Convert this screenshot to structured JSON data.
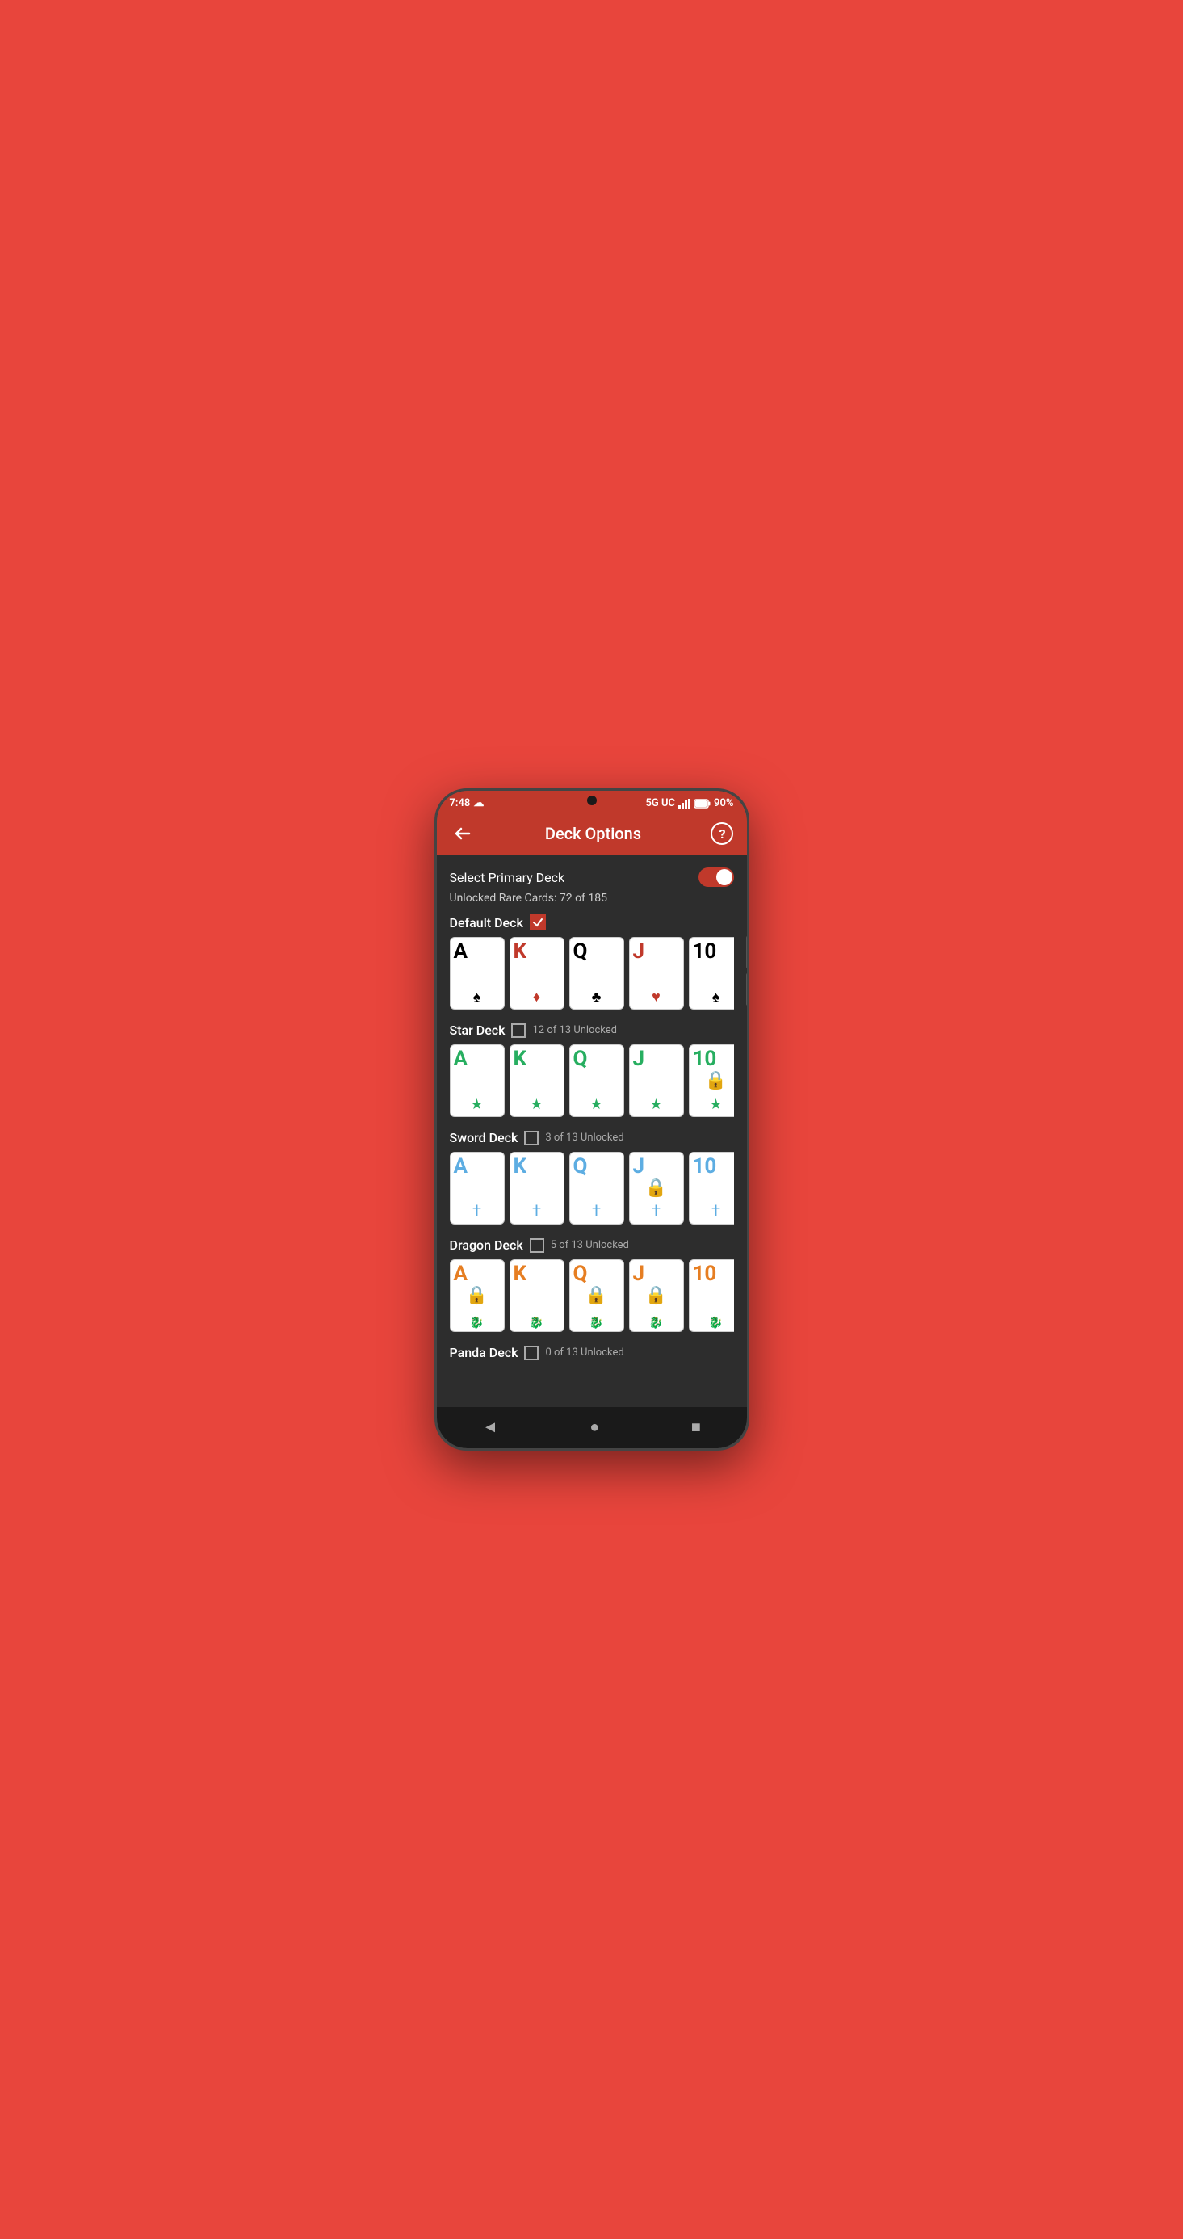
{
  "status_bar": {
    "time": "7:48",
    "network": "5G UC",
    "battery": "90%",
    "cloud_icon": "☁"
  },
  "app_bar": {
    "title": "Deck Options",
    "back_label": "←",
    "help_label": "?"
  },
  "options": {
    "select_primary_deck_label": "Select Primary Deck",
    "unlocked_rare_cards": "Unlocked Rare Cards: 72 of 185"
  },
  "decks": [
    {
      "name": "Default Deck",
      "checked": true,
      "unlock_count": null,
      "cards": [
        {
          "letter": "A",
          "suit": "♠",
          "suit_color": "black",
          "letter_color": "black",
          "locked": false
        },
        {
          "letter": "K",
          "suit": "♦",
          "suit_color": "red",
          "letter_color": "red",
          "locked": false
        },
        {
          "letter": "Q",
          "suit": "♣",
          "suit_color": "black",
          "letter_color": "black",
          "locked": false
        },
        {
          "letter": "J",
          "suit": "♥",
          "suit_color": "red",
          "letter_color": "red",
          "locked": false
        },
        {
          "letter": "10",
          "suit": "♠",
          "suit_color": "black",
          "letter_color": "black",
          "locked": false
        }
      ]
    },
    {
      "name": "Star Deck",
      "checked": false,
      "unlock_count": "12 of 13 Unlocked",
      "cards": [
        {
          "letter": "A",
          "suit": "★",
          "suit_color": "green",
          "letter_color": "green",
          "locked": false
        },
        {
          "letter": "K",
          "suit": "★",
          "suit_color": "green",
          "letter_color": "green",
          "locked": false
        },
        {
          "letter": "Q",
          "suit": "★",
          "suit_color": "green",
          "letter_color": "green",
          "locked": false
        },
        {
          "letter": "J",
          "suit": "★",
          "suit_color": "green",
          "letter_color": "green",
          "locked": false
        },
        {
          "letter": "10",
          "suit": "★",
          "suit_color": "green",
          "letter_color": "green",
          "locked": true
        }
      ]
    },
    {
      "name": "Sword Deck",
      "checked": false,
      "unlock_count": "3 of 13 Unlocked",
      "cards": [
        {
          "letter": "A",
          "suit": "⚔",
          "suit_color": "blue",
          "letter_color": "blue",
          "locked": false
        },
        {
          "letter": "K",
          "suit": "⚔",
          "suit_color": "blue",
          "letter_color": "blue",
          "locked": false
        },
        {
          "letter": "Q",
          "suit": "⚔",
          "suit_color": "blue",
          "letter_color": "blue",
          "locked": false
        },
        {
          "letter": "J",
          "suit": "⚔",
          "suit_color": "blue",
          "letter_color": "blue",
          "locked": true
        },
        {
          "letter": "10",
          "suit": "⚔",
          "suit_color": "blue",
          "letter_color": "blue",
          "locked": false
        }
      ]
    },
    {
      "name": "Dragon Deck",
      "checked": false,
      "unlock_count": "5 of 13 Unlocked",
      "cards": [
        {
          "letter": "A",
          "suit": "🐉",
          "suit_color": "orange",
          "letter_color": "orange",
          "locked": true
        },
        {
          "letter": "K",
          "suit": "🐉",
          "suit_color": "orange",
          "letter_color": "orange",
          "locked": false
        },
        {
          "letter": "Q",
          "suit": "🐉",
          "suit_color": "orange",
          "letter_color": "orange",
          "locked": true
        },
        {
          "letter": "J",
          "suit": "🐉",
          "suit_color": "orange",
          "letter_color": "orange",
          "locked": true
        },
        {
          "letter": "10",
          "suit": "🐉",
          "suit_color": "orange",
          "letter_color": "orange",
          "locked": false
        }
      ]
    },
    {
      "name": "Panda Deck",
      "checked": false,
      "unlock_count": "0 of 13 Unlocked",
      "cards": []
    }
  ],
  "bottom_nav": {
    "back": "◄",
    "home": "●",
    "recent": "■"
  }
}
